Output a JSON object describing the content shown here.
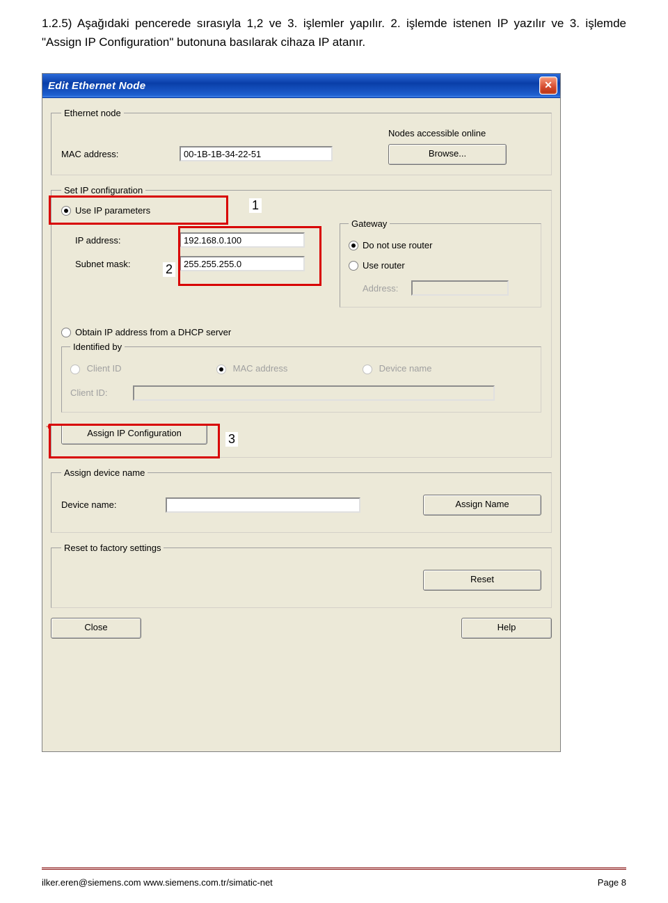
{
  "page": {
    "body_text": "1.2.5) Aşağıdaki pencerede sırasıyla 1,2 ve 3. işlemler yapılır.  2. işlemde istenen IP yazılır ve 3. işlemde \"Assign IP Configuration\" butonuna basılarak cihaza IP atanır.",
    "footer_left": "ilker.eren@siemens.com  www.siemens.com.tr/simatic-net",
    "footer_right": "Page 8"
  },
  "dialog": {
    "title": "Edit Ethernet Node",
    "ethernet_node": {
      "legend": "Ethernet node",
      "mac_label": "MAC address:",
      "mac_value": "00-1B-1B-34-22-51",
      "nodes_online_label": "Nodes accessible online",
      "browse_button": "Browse..."
    },
    "set_ip": {
      "legend": "Set IP configuration",
      "use_ip_params": "Use IP parameters",
      "ip_label": "IP address:",
      "ip_value": "192.168.0.100",
      "subnet_label": "Subnet mask:",
      "subnet_value": "255.255.255.0",
      "gateway_legend": "Gateway",
      "no_router": "Do not use router",
      "use_router": "Use router",
      "address_label": "Address:",
      "dhcp": "Obtain IP address from a DHCP server",
      "identified_legend": "Identified by",
      "opt_client_id": "Client ID",
      "opt_mac": "MAC address",
      "opt_device": "Device name",
      "client_id_label": "Client ID:",
      "assign_ip_button": "Assign IP Configuration"
    },
    "assign_device": {
      "legend": "Assign device name",
      "device_name_label": "Device name:",
      "device_name_value": "",
      "assign_name_button": "Assign Name"
    },
    "reset": {
      "legend": "Reset to factory settings",
      "reset_button": "Reset"
    },
    "buttons": {
      "close": "Close",
      "help": "Help"
    },
    "callouts": {
      "c1": "1",
      "c2": "2",
      "c3": "3"
    }
  }
}
